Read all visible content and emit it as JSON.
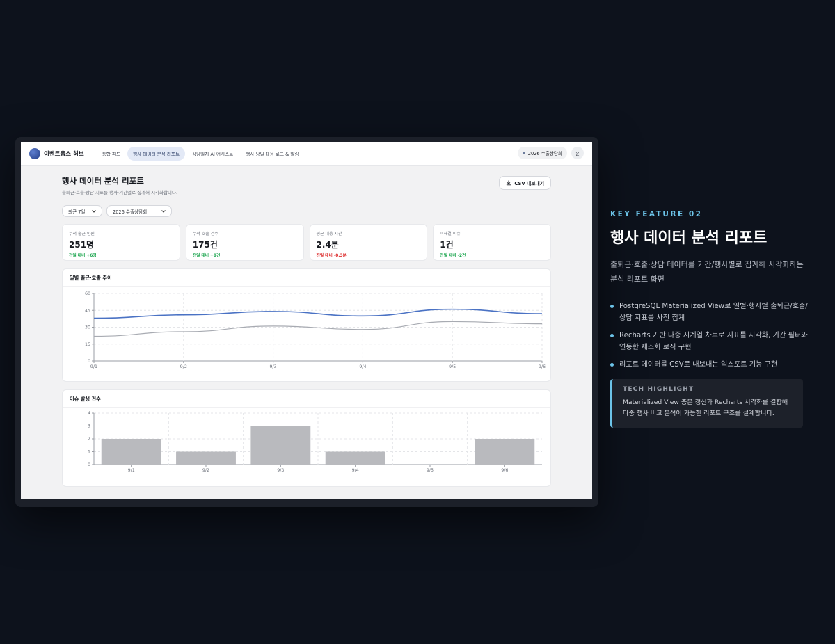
{
  "app": {
    "brand": "이벤트옵스 허브",
    "nav": [
      {
        "label": "통합 피드",
        "active": false
      },
      {
        "label": "행사 데이터 분석 리포트",
        "active": true
      },
      {
        "label": "상담일지 AI 어시스트",
        "active": false
      },
      {
        "label": "행사 당일 대응 로그 & 알림",
        "active": false
      }
    ],
    "event_selector": "2026 수출상담회",
    "avatar": "운"
  },
  "page": {
    "title": "행사 데이터 분석 리포트",
    "subtitle": "출퇴근·호출·상담 지표를 행사·기간별로 집계해 시각화합니다.",
    "csv_button": "CSV 내보내기",
    "filters": {
      "period": "최근 7일",
      "event": "2026 수출상담회"
    }
  },
  "kpis": [
    {
      "label": "누적 출근 인원",
      "value": "251명",
      "delta": "전일 대비 +6명",
      "delta_color": "#16a34a"
    },
    {
      "label": "누적 호출 건수",
      "value": "175건",
      "delta": "전일 대비 +9건",
      "delta_color": "#16a34a"
    },
    {
      "label": "평균 대응 시간",
      "value": "2.4분",
      "delta": "전일 대비 -0.3분",
      "delta_color": "#dc2626"
    },
    {
      "label": "미해결 이슈",
      "value": "1건",
      "delta": "전일 대비 -2건",
      "delta_color": "#16a34a"
    }
  ],
  "chart_data": [
    {
      "type": "line",
      "title": "일별 출근·호출 추이",
      "x": [
        "9/1",
        "9/2",
        "9/3",
        "9/4",
        "9/5",
        "9/6"
      ],
      "series": [
        {
          "values": [
            38,
            41,
            44,
            40,
            46,
            42
          ],
          "color": "#4a72c4"
        },
        {
          "values": [
            22,
            26,
            31,
            28,
            35,
            33
          ],
          "color": "#a8abb2"
        }
      ],
      "ylim": [
        0,
        60
      ],
      "yticks": [
        0,
        15,
        30,
        45,
        60
      ],
      "grid": true
    },
    {
      "type": "bar",
      "title": "이슈 발생 건수",
      "categories": [
        "9/1",
        "9/2",
        "9/3",
        "9/4",
        "9/5",
        "9/6"
      ],
      "values": [
        2,
        1,
        3,
        1,
        0,
        2
      ],
      "color": "#b9babe",
      "ylim": [
        0,
        4
      ],
      "yticks": [
        0,
        1,
        2,
        3,
        4
      ],
      "grid": true
    }
  ],
  "feature": {
    "kicker": "KEY FEATURE 02",
    "title": "행사 데이터 분석 리포트",
    "description": "출퇴근·호출·상담 데이터를 기간/행사별로 집계해 시각화하는 분석 리포트 화면",
    "bullets": [
      "PostgreSQL Materialized View로 일별·행사별 출퇴근/호출/상담 지표를 사전 집계",
      "Recharts 기반 다중 시계열 차트로 지표를 시각화, 기간 필터와 연동한 재조회 로직 구현",
      "리포트 데이터를 CSV로 내보내는 익스포트 기능 구현"
    ],
    "highlight_title": "TECH HIGHLIGHT",
    "highlight_text": "Materialized View 증분 갱신과 Recharts 시각화를 결합해 다중 행사 비교 분석이 가능한 리포트 구조를 설계합니다."
  }
}
